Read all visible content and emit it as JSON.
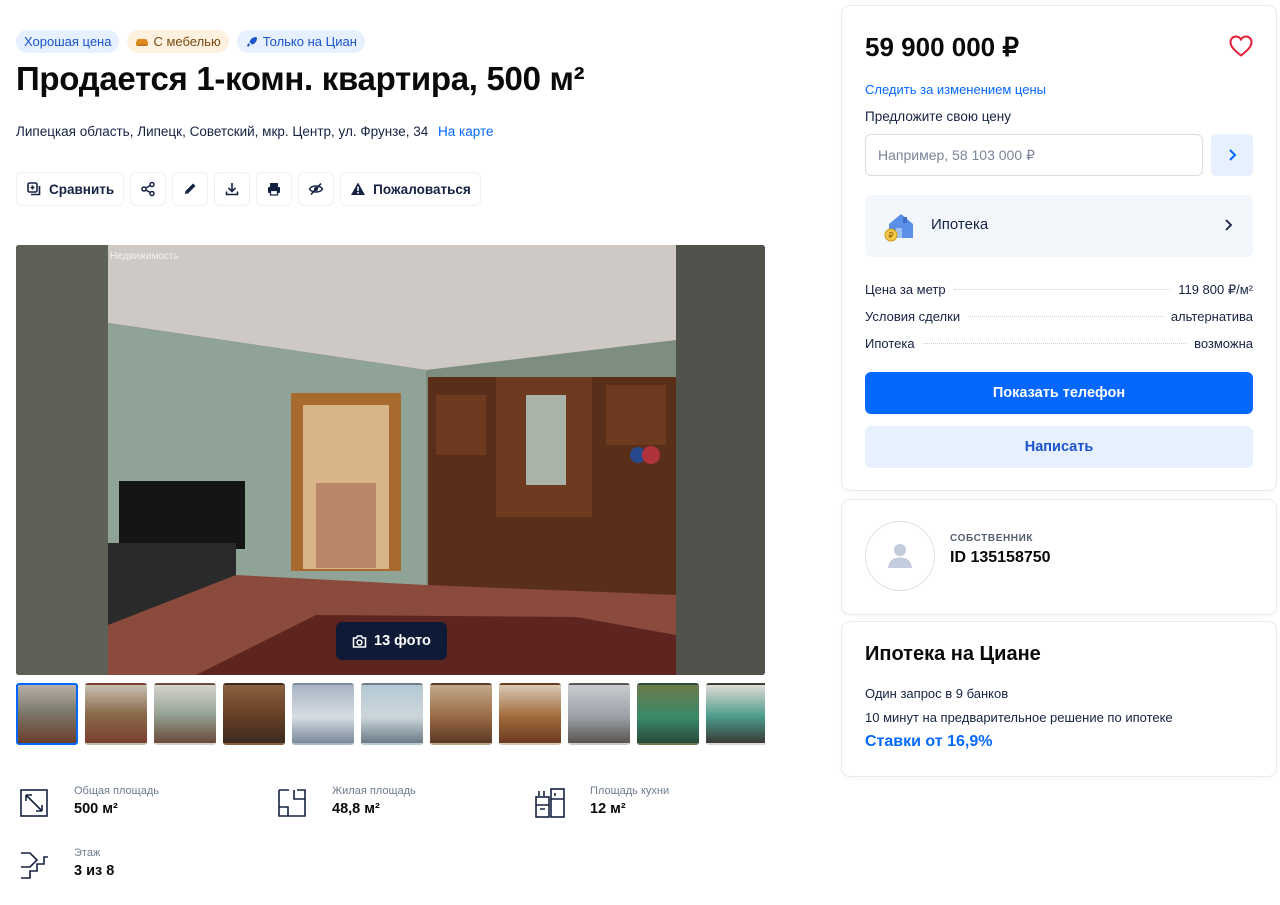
{
  "badges": [
    {
      "label": "Хорошая цена",
      "icon": "none"
    },
    {
      "label": "С мебелью",
      "icon": "armchair-icon"
    },
    {
      "label": "Только на Циан",
      "icon": "rocket-icon"
    }
  ],
  "listing": {
    "title": "Продается 1-комн. квартира, 500 м²",
    "address": "Липецкая область, Липецк, Советский, мкр. Центр, ул. Фрунзе, 34",
    "map_link": "На карте"
  },
  "toolbar": {
    "compare_label": "Сравнить",
    "icons": [
      "share-icon",
      "edit-icon",
      "download-icon",
      "print-icon",
      "hide-icon"
    ],
    "report_label": "Пожаловаться"
  },
  "gallery": {
    "watermark": "Недвижимость",
    "photo_count": "13 фото",
    "thumbnail_count": 11
  },
  "features": [
    {
      "label": "Общая площадь",
      "value": "500 м²",
      "icon": "total-area-icon"
    },
    {
      "label": "Жилая площадь",
      "value": "48,8 м²",
      "icon": "living-area-icon"
    },
    {
      "label": "Площадь кухни",
      "value": "12 м²",
      "icon": "kitchen-area-icon"
    },
    {
      "label": "Этаж",
      "value": "3 из 8",
      "icon": "floor-icon"
    }
  ],
  "price_card": {
    "price": "59 900 000 ₽",
    "follow_label": "Следить за изменением цены",
    "suggest_label": "Предложите свою цену",
    "input_placeholder": "Например, 58 103 000 ₽",
    "mortgage_label": "Ипотека",
    "params": [
      {
        "key": "Цена за метр",
        "value": "119 800 ₽/м²"
      },
      {
        "key": "Условия сделки",
        "value": "альтернатива"
      },
      {
        "key": "Ипотека",
        "value": "возможна"
      }
    ],
    "phone_button": "Показать телефон",
    "write_button": "Написать"
  },
  "owner": {
    "type": "СОБСТВЕННИК",
    "id": "ID 135158750"
  },
  "ipoteka": {
    "title": "Ипотека на Циане",
    "line1": "Один запрос в 9 банков",
    "line2": "10 минут на предварительное решение по ипотеке",
    "rate": "Ставки от 16,9%"
  },
  "colors": {
    "accent": "#0468ff",
    "accent_light": "#e6f0ff",
    "text": "#152242"
  }
}
